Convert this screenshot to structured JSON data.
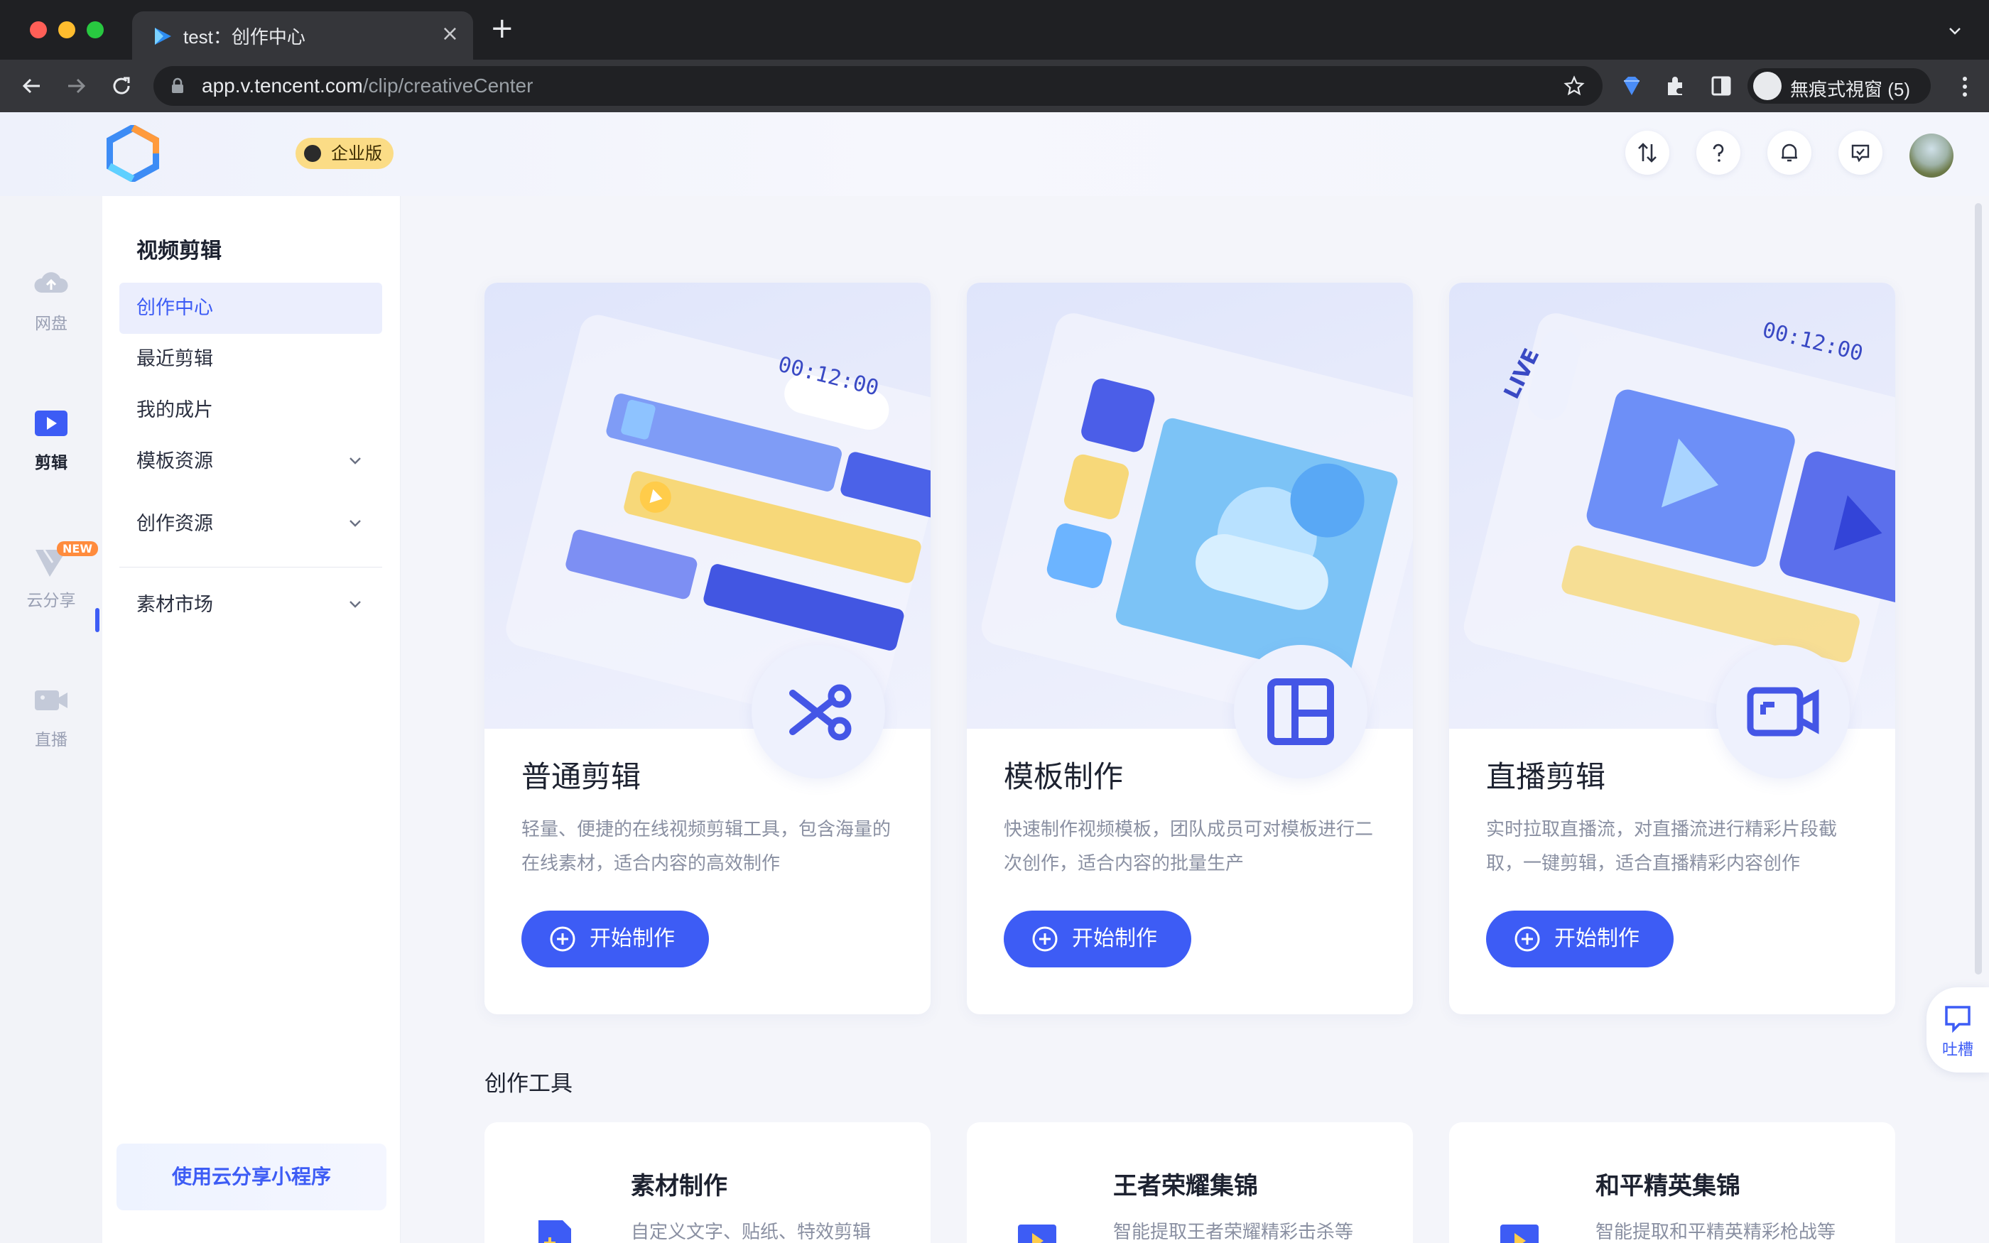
{
  "browser": {
    "tab_title": "test：创作中心",
    "url_host": "app.v.tencent.com",
    "url_path": "/clip/creativeCenter",
    "incognito_label": "無痕式視窗 (5)"
  },
  "header": {
    "edition_badge": "企业版"
  },
  "rail": {
    "items": [
      {
        "label": "网盘"
      },
      {
        "label": "剪辑"
      },
      {
        "label": "云分享",
        "badge": "NEW"
      },
      {
        "label": "直播"
      }
    ]
  },
  "sidebar": {
    "title": "视频剪辑",
    "items": [
      {
        "label": "创作中心"
      },
      {
        "label": "最近剪辑"
      },
      {
        "label": "我的成片"
      },
      {
        "label": "模板资源"
      },
      {
        "label": "创作资源"
      },
      {
        "label": "素材市场"
      }
    ],
    "cta": "使用云分享小程序"
  },
  "cards": [
    {
      "title": "普通剪辑",
      "desc": "轻量、便捷的在线视频剪辑工具，包含海量的在线素材，适合内容的高效制作",
      "button": "开始制作",
      "timecode": "00:12:00"
    },
    {
      "title": "模板制作",
      "desc": "快速制作视频模板，团队成员可对模板进行二次创作，适合内容的批量生产",
      "button": "开始制作"
    },
    {
      "title": "直播剪辑",
      "desc": "实时拉取直播流，对直播流进行精彩片段截取，一键剪辑，适合直播精彩内容创作",
      "button": "开始制作",
      "timecode": "00:12:00",
      "live": "LIVE"
    }
  ],
  "tools": {
    "section_title": "创作工具",
    "items": [
      {
        "title": "素材制作",
        "desc": "自定义文字、贴纸、特效剪辑"
      },
      {
        "title": "王者荣耀集锦",
        "desc": "智能提取王者荣耀精彩击杀等"
      },
      {
        "title": "和平精英集锦",
        "desc": "智能提取和平精英精彩枪战等"
      }
    ]
  },
  "feedback_label": "吐槽",
  "colors": {
    "accent": "#3d5cf5",
    "badge_gold": "#fbdc86",
    "new_badge": "#ff8b3d"
  }
}
